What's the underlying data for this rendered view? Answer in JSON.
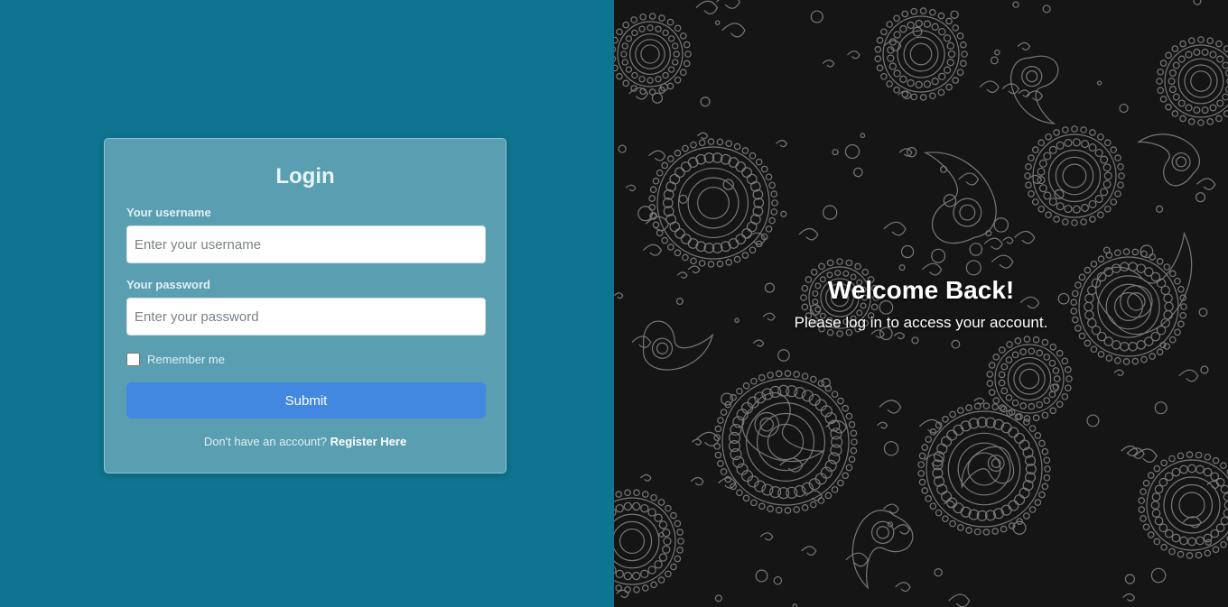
{
  "login": {
    "title": "Login",
    "username_label": "Your username",
    "username_placeholder": "Enter your username",
    "username_value": "",
    "password_label": "Your password",
    "password_placeholder": "Enter your password",
    "password_value": "",
    "remember_label": "Remember me",
    "remember_checked": false,
    "submit_label": "Submit",
    "register_prompt": "Don't have an account?",
    "register_link": "Register Here"
  },
  "hero": {
    "title": "Welcome Back!",
    "subtitle": "Please log in to access your account."
  },
  "colors": {
    "left_background": "#0e7490",
    "card_background": "#599fb1",
    "submit_button": "#4287e0",
    "right_background": "#151515",
    "pattern_line": "#9a9a9a"
  },
  "icons": {
    "background_pattern": "paisley-pattern"
  }
}
